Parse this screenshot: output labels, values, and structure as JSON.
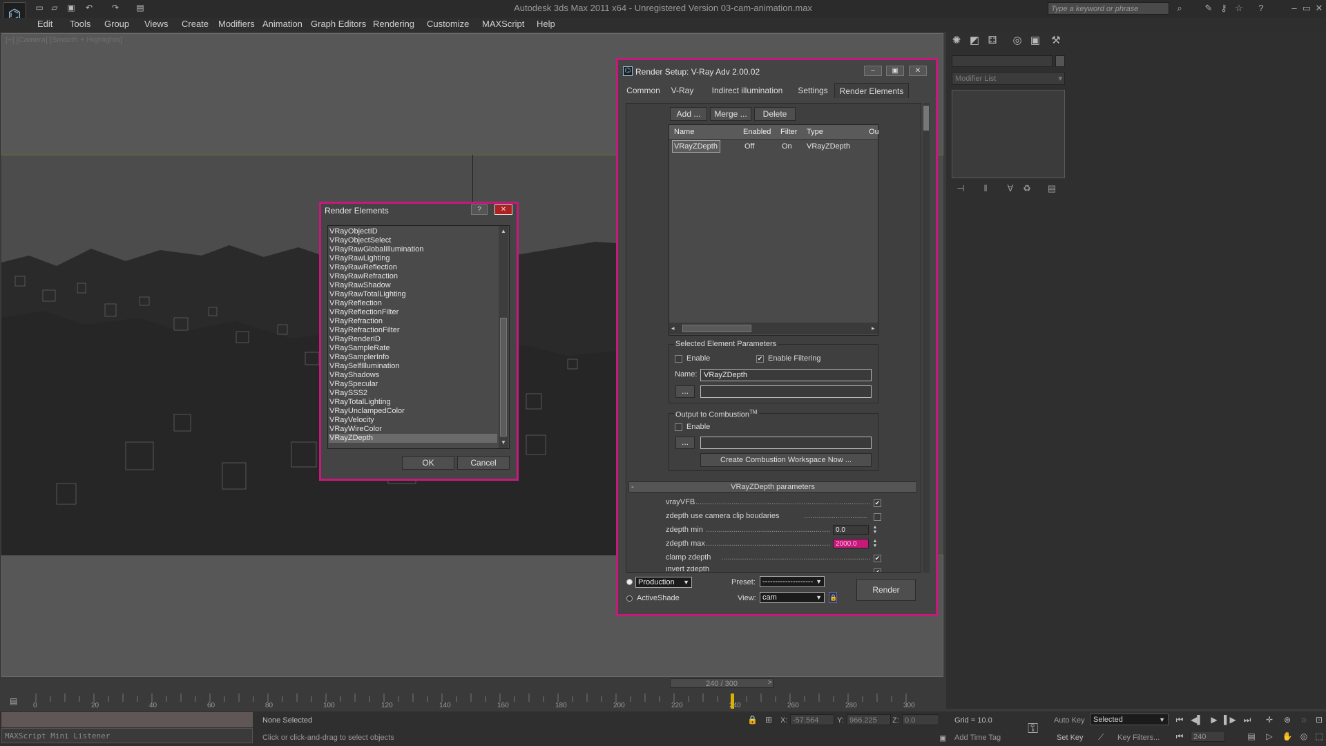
{
  "app": {
    "window_title": "Autodesk 3ds Max 2011 x64 - Unregistered Version   03-cam-animation.max",
    "search_placeholder": "Type a keyword or phrase",
    "menu": [
      "Edit",
      "Tools",
      "Group",
      "Views",
      "Create",
      "Modifiers",
      "Animation",
      "Graph Editors",
      "Rendering",
      "Customize",
      "MAXScript",
      "Help"
    ]
  },
  "viewport": {
    "label": "[+] [Camera] [Smooth + Highlights]"
  },
  "command_panel": {
    "modifier_list": "Modifier List"
  },
  "render_setup": {
    "title": "Render Setup: V-Ray Adv 2.00.02",
    "tabs": [
      "Common",
      "V-Ray",
      "Indirect illumination",
      "Settings",
      "Render Elements"
    ],
    "buttons": {
      "add": "Add ...",
      "merge": "Merge ...",
      "delete": "Delete"
    },
    "columns": [
      "Name",
      "Enabled",
      "Filter",
      "Type",
      "Ou"
    ],
    "rows": [
      {
        "name": "VRayZDepth",
        "enabled": "Off",
        "filter": "On",
        "type": "VRayZDepth"
      }
    ],
    "selected_params": {
      "title": "Selected Element Parameters",
      "enable": "Enable",
      "enable_filtering": "Enable Filtering",
      "name_label": "Name:",
      "name_value": "VRayZDepth",
      "browse": "..."
    },
    "combustion": {
      "title": "Output to Combustion",
      "tm": "TM",
      "enable": "Enable",
      "browse": "...",
      "create_button": "Create Combustion Workspace Now ..."
    },
    "zdepth": {
      "collapse": "-",
      "title": "VRayZDepth parameters",
      "params": [
        {
          "label": "vrayVFB",
          "type": "check",
          "checked": true
        },
        {
          "label": "zdepth use camera clip boudaries",
          "type": "check",
          "checked": false
        },
        {
          "label": "zdepth min",
          "type": "spinner",
          "value": "0.0"
        },
        {
          "label": "zdepth max",
          "type": "spinner",
          "value": "2000.0"
        },
        {
          "label": "clamp zdepth",
          "type": "check",
          "checked": true
        },
        {
          "label": "invert zdepth",
          "type": "check",
          "checked": true
        }
      ]
    },
    "footer": {
      "production": "Production",
      "activeshade": "ActiveShade",
      "preset_label": "Preset:",
      "preset_value": "--------------------",
      "view_label": "View:",
      "view_value": "cam",
      "render": "Render"
    }
  },
  "render_elements": {
    "title": "Render Elements",
    "help": "?",
    "close": "✕",
    "items": [
      "VRayObjectID",
      "VRayObjectSelect",
      "VRayRawGlobalIllumination",
      "VRayRawLighting",
      "VRayRawReflection",
      "VRayRawRefraction",
      "VRayRawShadow",
      "VRayRawTotalLighting",
      "VRayReflection",
      "VRayReflectionFilter",
      "VRayRefraction",
      "VRayRefractionFilter",
      "VRayRenderID",
      "VRaySampleRate",
      "VRaySamplerInfo",
      "VRaySelfIllumination",
      "VRayShadows",
      "VRaySpecular",
      "VRaySSS2",
      "VRayTotalLighting",
      "VRayUnclampedColor",
      "VRayVelocity",
      "VRayWireColor",
      "VRayZDepth"
    ],
    "selected_index": 23,
    "ok": "OK",
    "cancel": "Cancel"
  },
  "timeline": {
    "slider": "240 / 300",
    "ticks": [
      "0",
      "20",
      "40",
      "60",
      "80",
      "100",
      "120",
      "140",
      "160",
      "180",
      "200",
      "220",
      "240",
      "260",
      "280",
      "300"
    ],
    "current_frame": 240
  },
  "status": {
    "maxscript": "MAXScript Mini Listener",
    "selection": "None Selected",
    "prompt": "Click or click-and-drag to select objects",
    "x_label": "X:",
    "x": "-57.564",
    "y_label": "Y:",
    "y": "966.225",
    "z_label": "Z:",
    "z": "0.0",
    "grid": "Grid = 10.0",
    "add_time_tag": "Add Time Tag",
    "auto_key": "Auto Key",
    "set_key": "Set Key",
    "selected": "Selected",
    "key_filters": "Key Filters...",
    "frame": "240"
  }
}
